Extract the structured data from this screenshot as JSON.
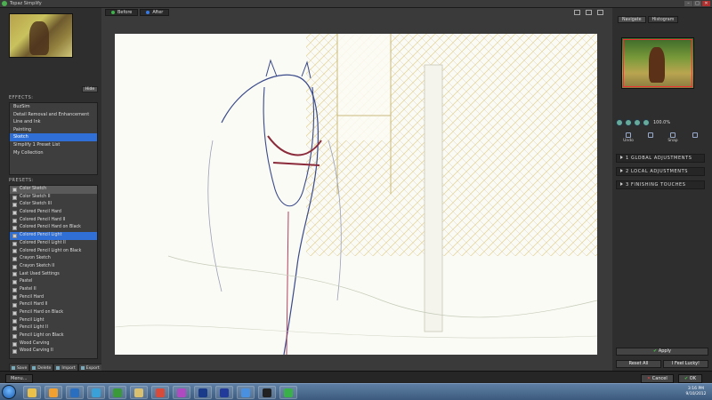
{
  "window": {
    "title": "Topaz Simplify",
    "controls": [
      "–",
      "□",
      "✕"
    ]
  },
  "left_panel": {
    "hide_label": "Hide",
    "effects_label": "EFFECTS:",
    "effects": [
      "BuzSim",
      "Detail Removal and Enhancement",
      "Line and Ink",
      "Painting",
      "Sketch",
      "Simplify 1 Preset List",
      "My Collection"
    ],
    "effects_selected": "Sketch",
    "presets_label": "PRESETS:",
    "presets": [
      "Color Sketch",
      "Color Sketch II",
      "Color Sketch III",
      "Colored Pencil Hard",
      "Colored Pencil Hard II",
      "Colored Pencil Hard on Black",
      "Colored Pencil Light",
      "Colored Pencil Light II",
      "Colored Pencil Light on Black",
      "Crayon Sketch",
      "Crayon Sketch II",
      "Last Used Settings",
      "Pastel",
      "Pastel II",
      "Pencil Hard",
      "Pencil Hard II",
      "Pencil Hard on Black",
      "Pencil Light",
      "Pencil Light II",
      "Pencil Light on Black",
      "Wood Carving",
      "Wood Carving II"
    ],
    "presets_selected": "Colored Pencil Light",
    "buttons": {
      "save": "Save",
      "delete": "Delete",
      "import": "Import",
      "export": "Export"
    }
  },
  "center": {
    "tab_before": "Before",
    "tab_after": "After"
  },
  "right_panel": {
    "tab_navigate": "Navigate",
    "tab_histogram": "Histogram",
    "zoom": "100.0%",
    "undo": "Undo",
    "snap": "Snap",
    "adjustments": [
      "1 GLOBAL ADJUSTMENTS",
      "2 LOCAL ADJUSTMENTS",
      "3 FINISHING TOUCHES"
    ],
    "apply": "Apply",
    "reset_all": "Reset All",
    "feel_lucky": "I Feel Lucky!"
  },
  "bottom_bar": {
    "menu": "Menu...",
    "cancel": "Cancel",
    "ok": "OK"
  },
  "taskbar": {
    "time": "3:16 PM",
    "date": "9/10/2012",
    "apps": [
      {
        "icon": "folder-icon",
        "color": "#e8c04a"
      },
      {
        "icon": "media-player-icon",
        "color": "#f0a030"
      },
      {
        "icon": "checkmark-app-icon",
        "color": "#2a6fbf"
      },
      {
        "icon": "droplet-app-icon",
        "color": "#3aa0d8"
      },
      {
        "icon": "spreadsheet-icon",
        "color": "#3a9a3a"
      },
      {
        "icon": "folder-icon-2",
        "color": "#d8c070"
      },
      {
        "icon": "chrome-icon",
        "color": "#d84a3a"
      },
      {
        "icon": "purple-app-icon",
        "color": "#b04ac0"
      },
      {
        "icon": "photoshop-icon",
        "color": "#1a3a8a"
      },
      {
        "icon": "photoshop-icon-2",
        "color": "#223a9a"
      },
      {
        "icon": "snowflake-app-icon",
        "color": "#4a90e0"
      },
      {
        "icon": "fx-app-icon",
        "color": "#222222"
      },
      {
        "icon": "topaz-icon",
        "color": "#3ab04a"
      }
    ]
  }
}
